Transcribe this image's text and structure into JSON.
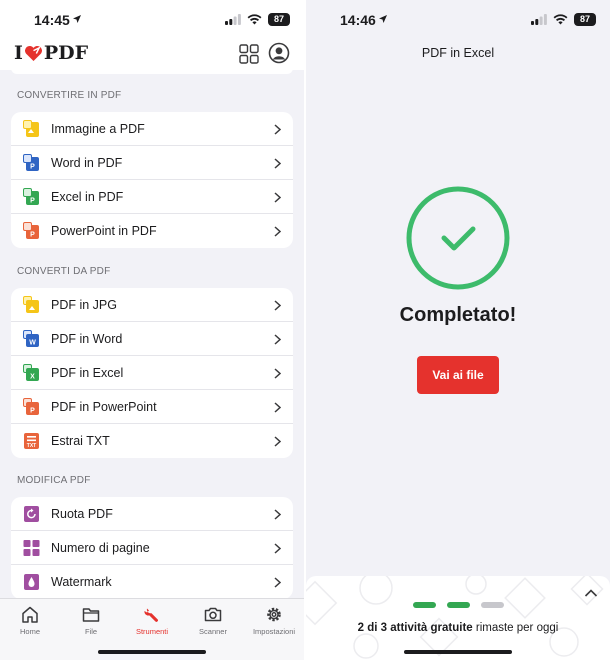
{
  "left": {
    "status": {
      "time": "14:45",
      "battery": "87"
    },
    "header": {
      "logo_pre": "I",
      "logo_post": "PDF"
    },
    "sections": [
      {
        "title": "CONVERTIRE IN PDF",
        "items": [
          {
            "label": "Immagine a PDF",
            "icon": "image-to-pdf-icon",
            "color": "#f5c518"
          },
          {
            "label": "Word in PDF",
            "icon": "word-to-pdf-icon",
            "color": "#2f64c3"
          },
          {
            "label": "Excel in PDF",
            "icon": "excel-to-pdf-icon",
            "color": "#33a752"
          },
          {
            "label": "PowerPoint in PDF",
            "icon": "powerpoint-to-pdf-icon",
            "color": "#e8643b"
          }
        ]
      },
      {
        "title": "CONVERTI DA PDF",
        "items": [
          {
            "label": "PDF in JPG",
            "icon": "pdf-to-jpg-icon",
            "color": "#f5c518"
          },
          {
            "label": "PDF in Word",
            "icon": "pdf-to-word-icon",
            "color": "#2f64c3"
          },
          {
            "label": "PDF in Excel",
            "icon": "pdf-to-excel-icon",
            "color": "#33a752"
          },
          {
            "label": "PDF in PowerPoint",
            "icon": "pdf-to-powerpoint-icon",
            "color": "#e8643b"
          },
          {
            "label": "Estrai TXT",
            "icon": "extract-txt-icon",
            "color": "#e8643b"
          }
        ]
      },
      {
        "title": "MODIFICA PDF",
        "items": [
          {
            "label": "Ruota PDF",
            "icon": "rotate-pdf-icon",
            "color": "#a04ea0"
          },
          {
            "label": "Numero di pagine",
            "icon": "page-numbers-icon",
            "color": "#a04ea0"
          },
          {
            "label": "Watermark",
            "icon": "watermark-icon",
            "color": "#a04ea0"
          }
        ]
      }
    ],
    "tabs": [
      {
        "label": "Home",
        "icon": "home-icon"
      },
      {
        "label": "File",
        "icon": "folder-icon"
      },
      {
        "label": "Strumenti",
        "icon": "wrench-icon",
        "active": true
      },
      {
        "label": "Scanner",
        "icon": "camera-icon"
      },
      {
        "label": "Impostazioni",
        "icon": "gear-icon"
      }
    ]
  },
  "right": {
    "status": {
      "time": "14:46",
      "battery": "87"
    },
    "title": "PDF in Excel",
    "done": "Completato!",
    "button": "Vai ai file",
    "remaining_prefix": "2 di 3 attività gratuite",
    "remaining_suffix": "rimaste per oggi",
    "progress": [
      "#33a752",
      "#33a752",
      "#c7c7cc"
    ]
  },
  "colors": {
    "accent": "#e5322d",
    "success": "#3dbb6b"
  }
}
